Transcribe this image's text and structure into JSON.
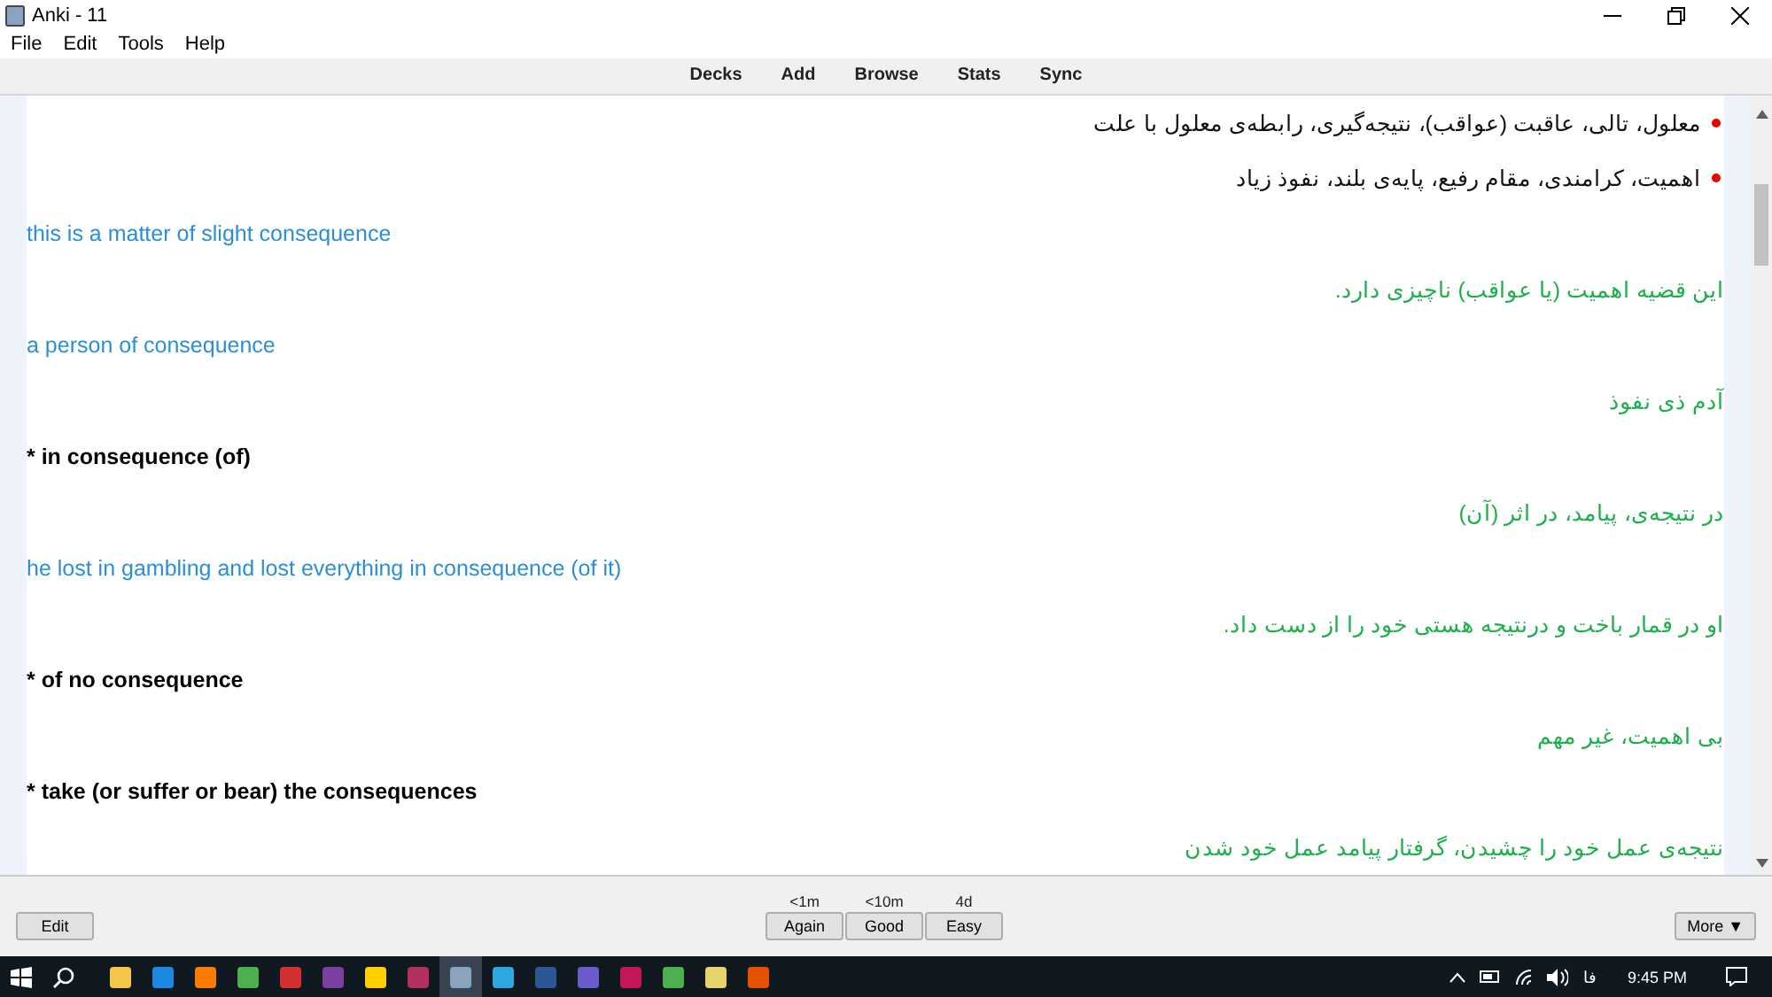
{
  "window": {
    "title": "Anki - 11"
  },
  "menu": [
    "File",
    "Edit",
    "Tools",
    "Help"
  ],
  "toolbar": [
    "Decks",
    "Add",
    "Browse",
    "Stats",
    "Sync"
  ],
  "lines": [
    {
      "kind": "bullet",
      "text": "معلول، تالی، عاقبت (عواقب)، نتیجه‌گیری، رابطه‌ی معلول با علت"
    },
    {
      "kind": "bullet",
      "text": "اهمیت، کرامندی، مقام رفیع، پایه‌ی بلند، نفوذ زیاد"
    },
    {
      "kind": "example",
      "text": "this is a matter of slight consequence"
    },
    {
      "kind": "translation",
      "text": "این قضیه اهمیت (یا عواقب) ناچیزی دارد."
    },
    {
      "kind": "example",
      "text": "a person of consequence"
    },
    {
      "kind": "translation",
      "text": "آدم ذی نفوذ"
    },
    {
      "kind": "phrase",
      "text": "* in consequence (of)"
    },
    {
      "kind": "translation",
      "text": "در نتیجه‌ی، پیامد، در اثر (آن)"
    },
    {
      "kind": "example",
      "text": "he lost in gambling and lost everything in consequence (of it)"
    },
    {
      "kind": "translation",
      "text": "او در قمار باخت و درنتیجه هستی خود را از دست داد."
    },
    {
      "kind": "phrase",
      "text": "* of no consequence"
    },
    {
      "kind": "translation",
      "text": "بی اهمیت، غیر مهم"
    },
    {
      "kind": "phrase",
      "text": "* take (or suffer or bear) the consequences"
    },
    {
      "kind": "translation",
      "text": "نتیجه‌ی عمل خود را چشیدن، گرفتار پیامد عمل خود شدن"
    }
  ],
  "bottom_bar": {
    "edit": "Edit",
    "answers": [
      {
        "label": "Again",
        "interval": "<1m"
      },
      {
        "label": "Good",
        "interval": "<10m"
      },
      {
        "label": "Easy",
        "interval": "4d"
      }
    ],
    "more": "More ▼"
  },
  "taskbar": {
    "language": "فا",
    "time": "9:45 PM"
  }
}
